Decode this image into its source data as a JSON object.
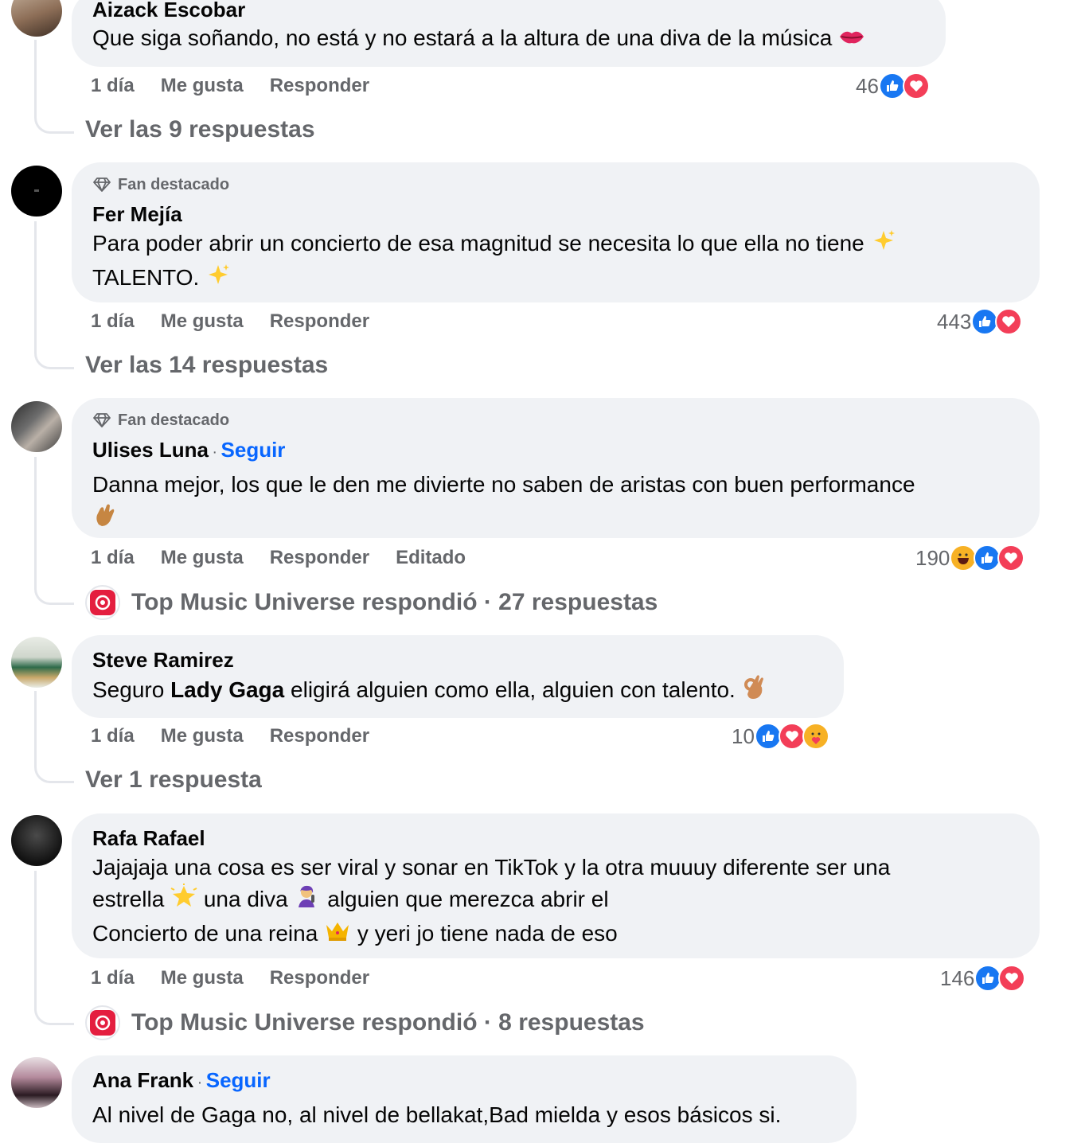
{
  "comments": [
    {
      "author": "Aizack Escobar",
      "text": "Que siga soñando, no está y no estará a la altura de una diva de la música",
      "time": "1 día",
      "like": "Me gusta",
      "reply": "Responder",
      "reaction_count": "46",
      "reactions": [
        "like-icon",
        "love-icon"
      ],
      "replies": "Ver las 9 respuestas"
    },
    {
      "badge": "Fan destacado",
      "author": "Fer Mejía",
      "text_line1": "Para poder abrir un concierto de esa magnitud se necesita lo que ella no tiene",
      "text_line2": "TALENTO.",
      "time": "1 día",
      "like": "Me gusta",
      "reply": "Responder",
      "reaction_count": "443",
      "reactions": [
        "like-icon",
        "love-icon"
      ],
      "replies": "Ver las 14 respuestas"
    },
    {
      "badge": "Fan destacado",
      "author": "Ulises Luna",
      "follow": "Seguir",
      "sep": "·",
      "text": "Danna mejor, los que le den me divierte no saben de aristas con buen performance",
      "time": "1 día",
      "like": "Me gusta",
      "reply": "Responder",
      "edited": "Editado",
      "reaction_count": "190",
      "reactions": [
        "haha-icon",
        "like-icon",
        "love-icon"
      ],
      "replies": "Top Music Universe respondió · 27 respuestas"
    },
    {
      "author": "Steve Ramirez",
      "text_before": "Seguro ",
      "text_bold": "Lady Gaga",
      "text_after": " eligirá alguien como ella, alguien con talento.",
      "time": "1 día",
      "like": "Me gusta",
      "reply": "Responder",
      "reaction_count": "10",
      "reactions": [
        "like-icon",
        "love-icon",
        "care-icon"
      ],
      "replies": "Ver 1 respuesta"
    },
    {
      "author": "Rafa Rafael",
      "text_line1": "Jajajaja una cosa es ser viral y sonar en TikTok y la otra muuuy diferente ser una",
      "text_line2a": "estrella",
      "text_line2b": "una diva",
      "text_line2c": "alguien que merezca abrir el",
      "text_line3a": "Concierto de una reina",
      "text_line3b": "y yeri jo tiene nada de eso",
      "time": "1 día",
      "like": "Me gusta",
      "reply": "Responder",
      "reaction_count": "146",
      "reactions": [
        "like-icon",
        "love-icon"
      ],
      "replies": "Top Music Universe respondió · 8 respuestas"
    },
    {
      "author": "Ana Frank",
      "follow": "Seguir",
      "sep": "·",
      "text": "Al nivel de Gaga no, al nivel de bellakat,Bad mielda y esos básicos si."
    }
  ],
  "colors": {
    "bubble": "#f0f2f5",
    "meta": "#65676b",
    "link": "#0866ff",
    "like": "#1877f2",
    "love": "#f33e58"
  }
}
